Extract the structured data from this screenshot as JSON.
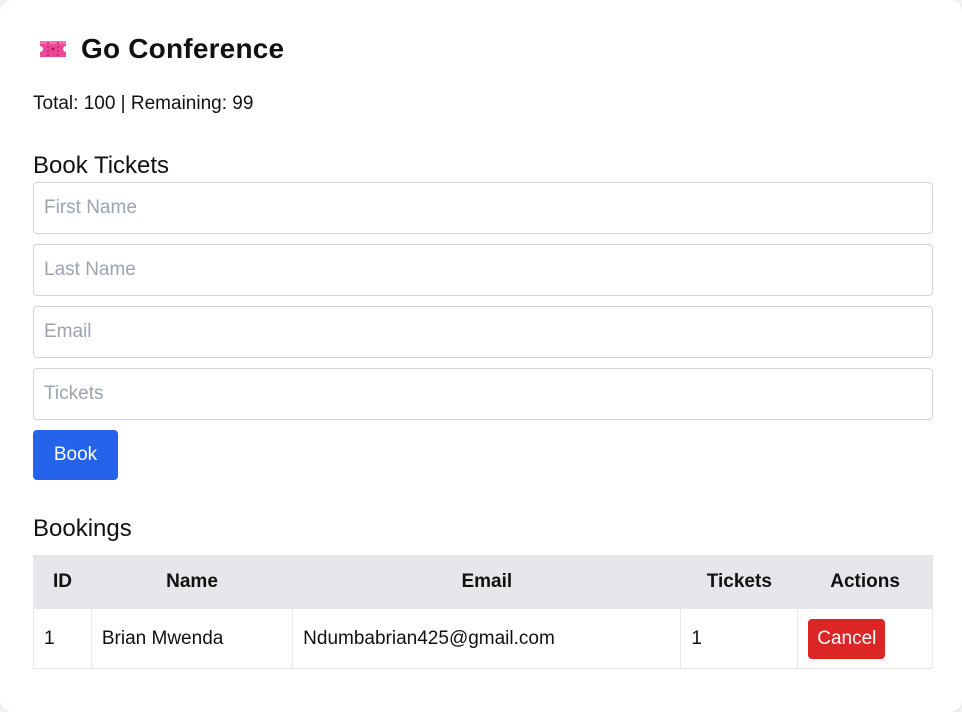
{
  "header": {
    "icon": "ticket-icon",
    "icon_color": "#ec4899",
    "title": "Go Conference",
    "stats": "Total: 100 | Remaining: 99"
  },
  "book_form": {
    "title": "Book Tickets",
    "first_name_placeholder": "First Name",
    "last_name_placeholder": "Last Name",
    "email_placeholder": "Email",
    "tickets_placeholder": "Tickets",
    "submit_label": "Book"
  },
  "bookings": {
    "title": "Bookings",
    "columns": [
      "ID",
      "Name",
      "Email",
      "Tickets",
      "Actions"
    ],
    "rows": [
      {
        "id": "1",
        "name": "Brian Mwenda",
        "email": "Ndumbabrian425@gmail.com",
        "tickets": "1",
        "action_label": "Cancel"
      }
    ]
  },
  "colors": {
    "primary": "#2563eb",
    "danger": "#dc2626",
    "header_bg": "#e5e7eb"
  }
}
